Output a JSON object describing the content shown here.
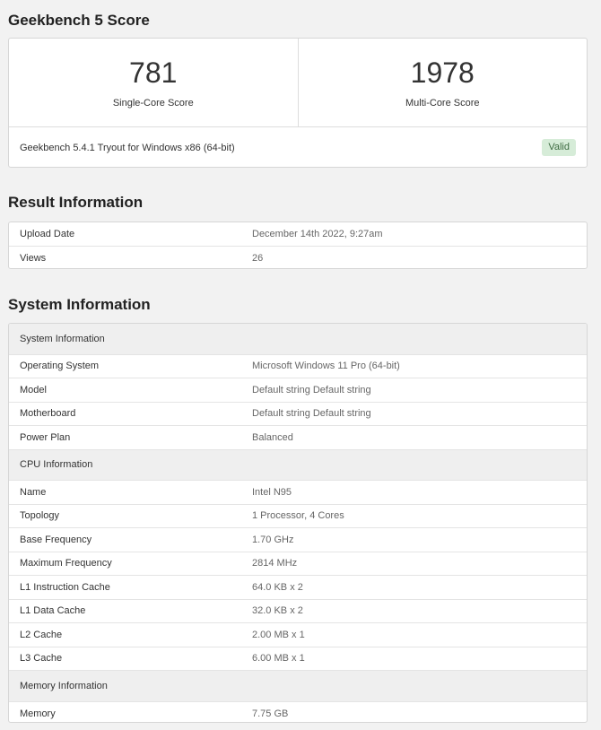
{
  "score": {
    "title": "Geekbench 5 Score",
    "single_core_value": "781",
    "single_core_label": "Single-Core Score",
    "multi_core_value": "1978",
    "multi_core_label": "Multi-Core Score",
    "version": "Geekbench 5.4.1 Tryout for Windows x86 (64-bit)",
    "badge": "Valid"
  },
  "result": {
    "title": "Result Information",
    "rows": [
      {
        "key": "Upload Date",
        "value": "December 14th 2022, 9:27am"
      },
      {
        "key": "Views",
        "value": "26"
      }
    ]
  },
  "system": {
    "title": "System Information",
    "groups": [
      {
        "heading": "System Information",
        "rows": [
          {
            "key": "Operating System",
            "value": "Microsoft Windows 11 Pro (64-bit)"
          },
          {
            "key": "Model",
            "value": "Default string Default string"
          },
          {
            "key": "Motherboard",
            "value": "Default string Default string"
          },
          {
            "key": "Power Plan",
            "value": "Balanced"
          }
        ]
      },
      {
        "heading": "CPU Information",
        "rows": [
          {
            "key": "Name",
            "value": "Intel N95"
          },
          {
            "key": "Topology",
            "value": "1 Processor, 4 Cores"
          },
          {
            "key": "Base Frequency",
            "value": "1.70 GHz"
          },
          {
            "key": "Maximum Frequency",
            "value": "2814 MHz"
          },
          {
            "key": "L1 Instruction Cache",
            "value": "64.0 KB x 2"
          },
          {
            "key": "L1 Data Cache",
            "value": "32.0 KB x 2"
          },
          {
            "key": "L2 Cache",
            "value": "2.00 MB x 1"
          },
          {
            "key": "L3 Cache",
            "value": "6.00 MB x 1"
          }
        ]
      },
      {
        "heading": "Memory Information",
        "rows": [
          {
            "key": "Memory",
            "value": "7.75 GB"
          }
        ]
      }
    ]
  },
  "colors": {
    "page_background": "#f2f2f2",
    "card_background": "#ffffff",
    "group_header_background": "#efefef",
    "valid_badge_background": "#d6ecd8",
    "valid_badge_text": "#3e6b42"
  }
}
